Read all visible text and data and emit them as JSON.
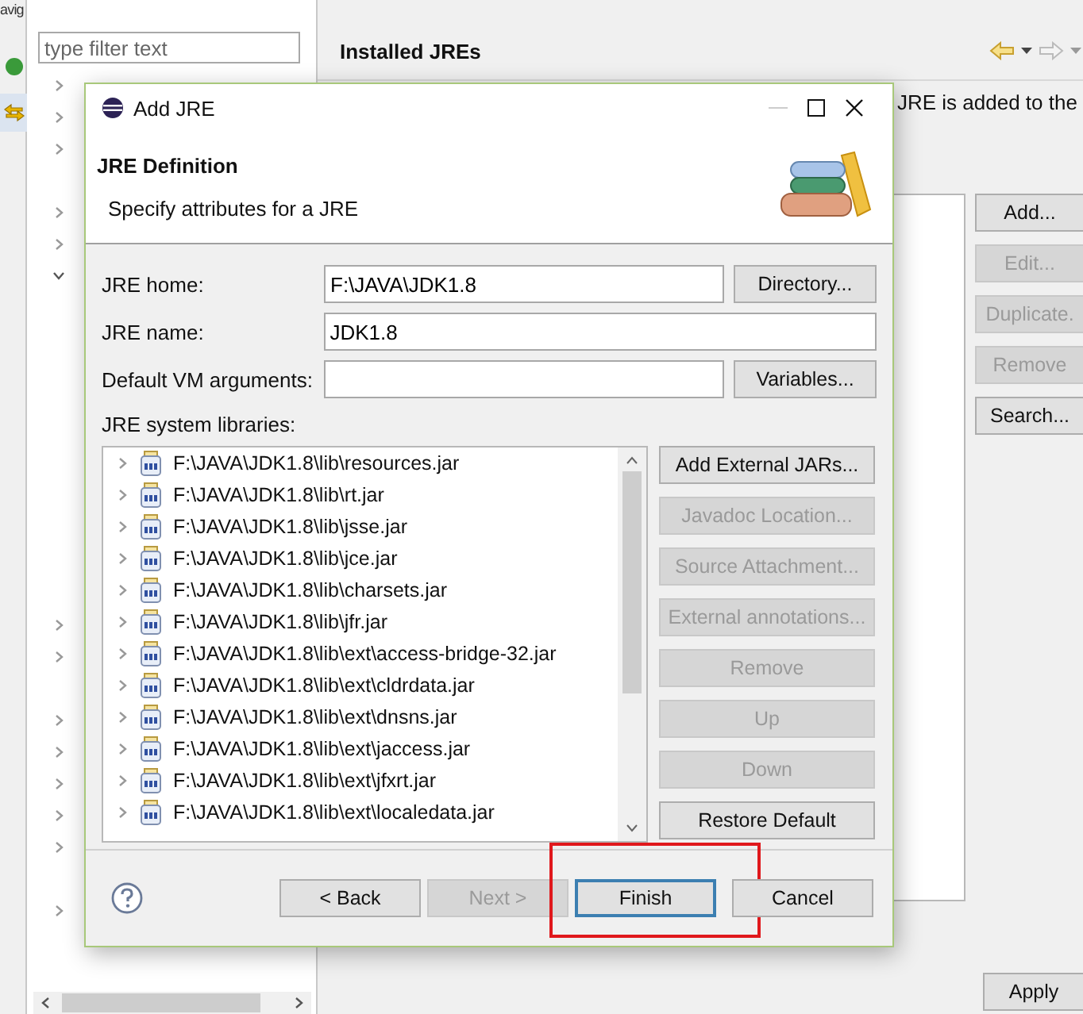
{
  "side_strip": {
    "fragment": "avig"
  },
  "preferences": {
    "filter": {
      "placeholder": "type filter text"
    },
    "tree": [
      {
        "kind": "folder",
        "expanded": false
      },
      {
        "kind": "folder",
        "expanded": false
      },
      {
        "kind": "folder",
        "expanded": false
      },
      {
        "kind": "leaf"
      },
      {
        "kind": "folder",
        "expanded": false
      },
      {
        "kind": "folder",
        "expanded": false
      },
      {
        "kind": "folder",
        "expanded": true
      },
      {
        "kind": "folder",
        "expanded": false
      },
      {
        "kind": "folder",
        "expanded": false
      },
      {
        "kind": "leaf"
      },
      {
        "kind": "folder",
        "expanded": false
      },
      {
        "kind": "folder",
        "expanded": false
      },
      {
        "kind": "folder",
        "expanded": false
      },
      {
        "kind": "folder",
        "expanded": false
      },
      {
        "kind": "folder",
        "expanded": false
      },
      {
        "kind": "leaf"
      },
      {
        "kind": "folder",
        "expanded": false
      }
    ],
    "page_title": "Installed JREs",
    "description": "JRE is added to the",
    "buttons": [
      {
        "label": "Add...",
        "disabled": false
      },
      {
        "label": "Edit...",
        "disabled": true
      },
      {
        "label": "Duplicate.",
        "disabled": true
      },
      {
        "label": "Remove",
        "disabled": true
      },
      {
        "label": "Search...",
        "disabled": false
      }
    ],
    "apply": "Apply"
  },
  "dialog": {
    "title": "Add JRE",
    "heading": "JRE Definition",
    "subtitle": "Specify attributes for a JRE",
    "fields": [
      {
        "label": "JRE home:",
        "value": "F:\\JAVA\\JDK1.8",
        "button": "Directory..."
      },
      {
        "label": "JRE name:",
        "value": "JDK1.8"
      },
      {
        "label": "Default VM arguments:",
        "button": "Variables..."
      }
    ],
    "libraries_label": "JRE system libraries:",
    "libraries": [
      "F:\\JAVA\\JDK1.8\\lib\\resources.jar",
      "F:\\JAVA\\JDK1.8\\lib\\rt.jar",
      "F:\\JAVA\\JDK1.8\\lib\\jsse.jar",
      "F:\\JAVA\\JDK1.8\\lib\\jce.jar",
      "F:\\JAVA\\JDK1.8\\lib\\charsets.jar",
      "F:\\JAVA\\JDK1.8\\lib\\jfr.jar",
      "F:\\JAVA\\JDK1.8\\lib\\ext\\access-bridge-32.jar",
      "F:\\JAVA\\JDK1.8\\lib\\ext\\cldrdata.jar",
      "F:\\JAVA\\JDK1.8\\lib\\ext\\dnsns.jar",
      "F:\\JAVA\\JDK1.8\\lib\\ext\\jaccess.jar",
      "F:\\JAVA\\JDK1.8\\lib\\ext\\jfxrt.jar",
      "F:\\JAVA\\JDK1.8\\lib\\ext\\localedata.jar"
    ],
    "side_buttons": [
      {
        "label": "Add External JARs...",
        "disabled": false
      },
      {
        "label": "Javadoc Location...",
        "disabled": true
      },
      {
        "label": "Source Attachment...",
        "disabled": true
      },
      {
        "label": "External annotations...",
        "disabled": true
      },
      {
        "label": "Remove",
        "disabled": true
      },
      {
        "label": "Up",
        "disabled": true
      },
      {
        "label": "Down",
        "disabled": true
      },
      {
        "label": "Restore Default",
        "disabled": false
      }
    ],
    "nav_buttons": [
      {
        "label": "< Back",
        "disabled": false,
        "default": false,
        "annotated": false
      },
      {
        "label": "Next >",
        "disabled": true,
        "default": false,
        "annotated": false
      },
      {
        "label": "Finish",
        "disabled": false,
        "default": true,
        "annotated": true
      },
      {
        "label": "Cancel",
        "disabled": false,
        "default": false,
        "annotated": false
      }
    ]
  }
}
